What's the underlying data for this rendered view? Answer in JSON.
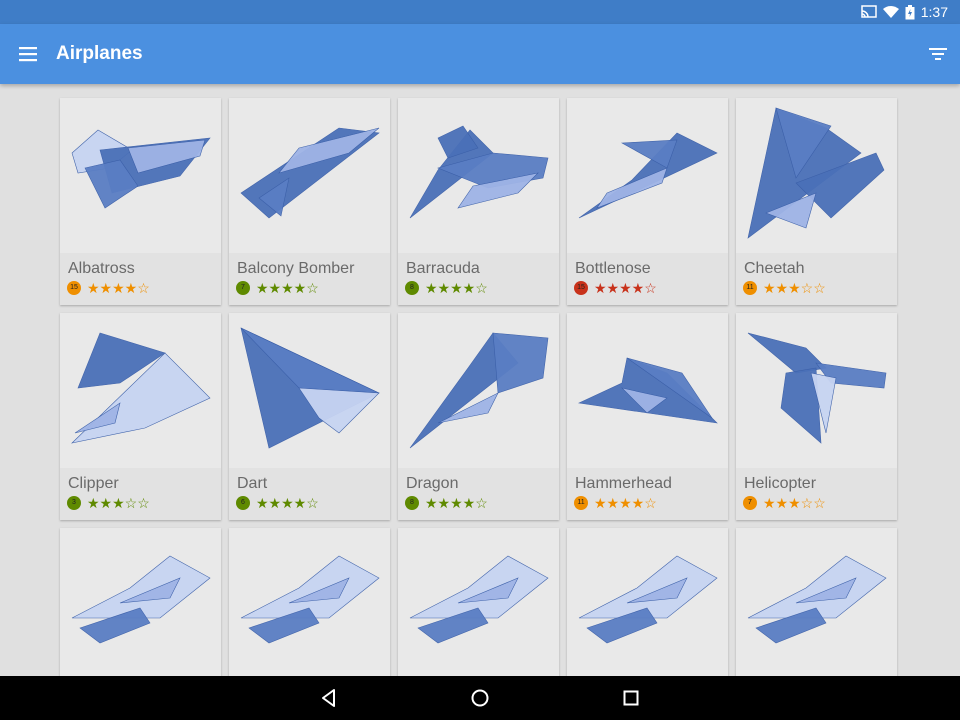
{
  "status": {
    "time": "1:37"
  },
  "appbar": {
    "title": "Airplanes"
  },
  "colors": {
    "statusbar": "#3f7dc7",
    "appbar": "#4b90e0",
    "plane_dark": "#4a70b8",
    "plane_light": "#c7d4f2",
    "orange": "#ef8f00",
    "green": "#5f8a00",
    "red": "#c8321b"
  },
  "airplanes": [
    {
      "name": "Albatross",
      "level": "15",
      "rating": 4,
      "color": "#ef8f00",
      "icon": "albatross-plane"
    },
    {
      "name": "Balcony Bomber",
      "level": "7",
      "rating": 4,
      "color": "#5f8a00",
      "icon": "balcony-bomber-plane"
    },
    {
      "name": "Barracuda",
      "level": "8",
      "rating": 4,
      "color": "#5f8a00",
      "icon": "barracuda-plane"
    },
    {
      "name": "Bottlenose",
      "level": "15",
      "rating": 4,
      "color": "#c8321b",
      "icon": "bottlenose-plane"
    },
    {
      "name": "Cheetah",
      "level": "11",
      "rating": 3,
      "color": "#ef8f00",
      "icon": "cheetah-plane"
    },
    {
      "name": "Clipper",
      "level": "3",
      "rating": 3,
      "color": "#5f8a00",
      "icon": "clipper-plane"
    },
    {
      "name": "Dart",
      "level": "6",
      "rating": 4,
      "color": "#5f8a00",
      "icon": "dart-plane"
    },
    {
      "name": "Dragon",
      "level": "8",
      "rating": 4,
      "color": "#5f8a00",
      "icon": "dragon-plane"
    },
    {
      "name": "Hammerhead",
      "level": "11",
      "rating": 4,
      "color": "#ef8f00",
      "icon": "hammerhead-plane"
    },
    {
      "name": "Helicopter",
      "level": "7",
      "rating": 3,
      "color": "#ef8f00",
      "icon": "helicopter-plane"
    },
    {
      "icon": "paper-plane"
    },
    {
      "icon": "paper-plane"
    },
    {
      "icon": "paper-plane"
    },
    {
      "icon": "paper-plane"
    },
    {
      "icon": "paper-plane"
    }
  ],
  "icons": {
    "menu": "menu-icon",
    "filter": "filter-icon",
    "back": "back-icon",
    "home": "home-icon",
    "recents": "recents-icon"
  }
}
